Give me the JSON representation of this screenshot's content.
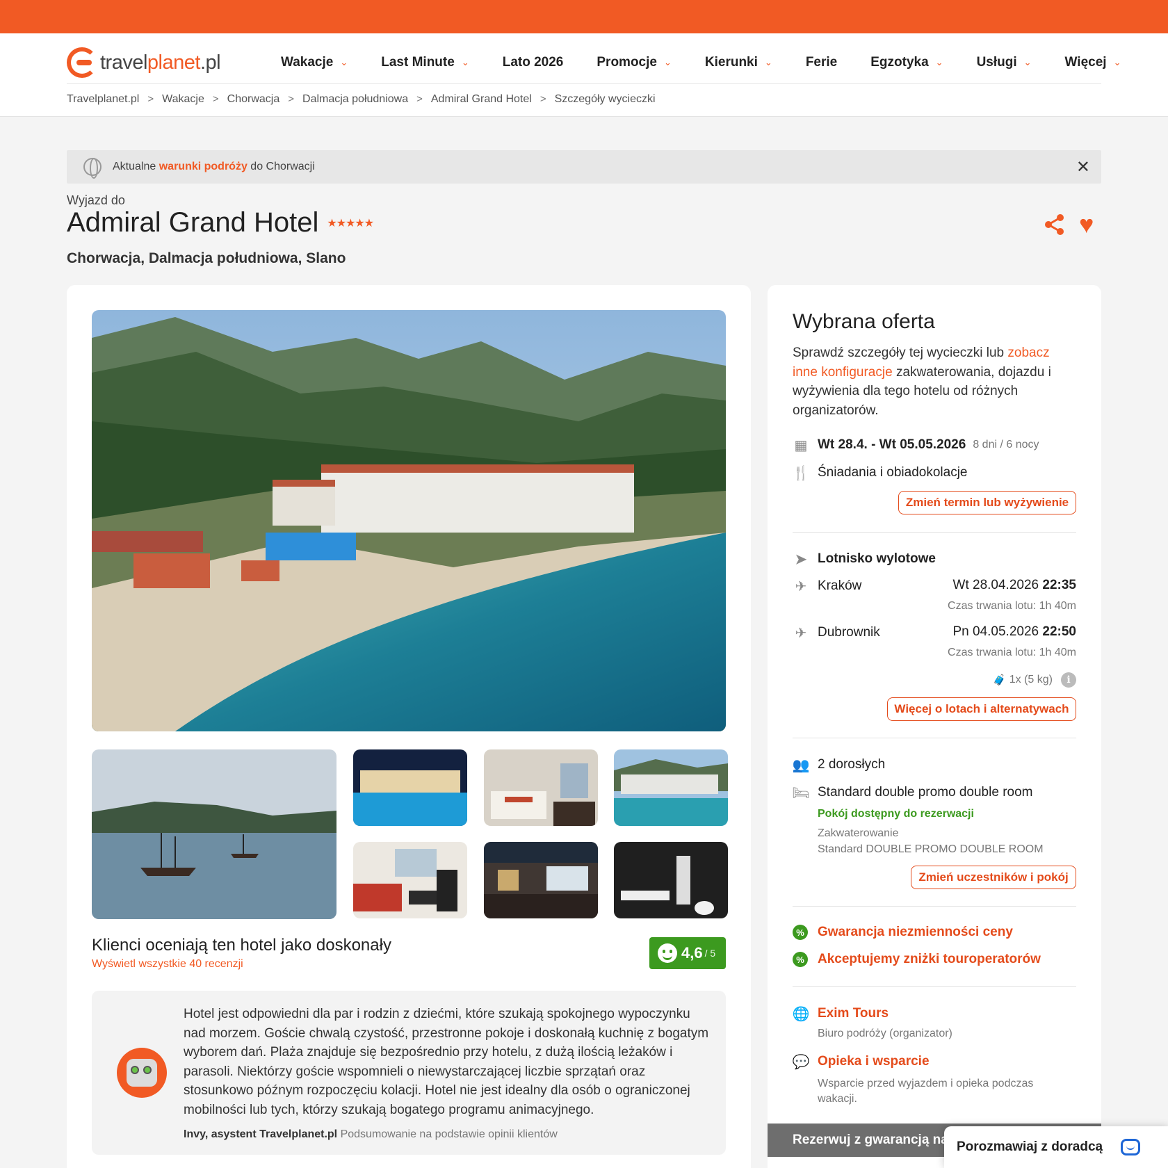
{
  "header": {
    "logo": {
      "part1": "travel",
      "part2": "planet",
      "part3": ".pl"
    },
    "nav": [
      {
        "label": "Wakacje",
        "dropdown": true
      },
      {
        "label": "Last Minute",
        "dropdown": true
      },
      {
        "label": "Lato 2026",
        "dropdown": false
      },
      {
        "label": "Promocje",
        "dropdown": true
      },
      {
        "label": "Kierunki",
        "dropdown": true
      },
      {
        "label": "Ferie",
        "dropdown": false
      },
      {
        "label": "Egzotyka",
        "dropdown": true
      },
      {
        "label": "Usługi",
        "dropdown": true
      },
      {
        "label": "Więcej",
        "dropdown": true
      }
    ],
    "breadcrumb": [
      "Travelplanet.pl",
      "Wakacje",
      "Chorwacja",
      "Dalmacja południowa",
      "Admiral Grand Hotel",
      "Szczegóły wycieczki"
    ]
  },
  "notice": {
    "prefix": "Aktualne",
    "link": "warunki podróży",
    "suffix": "do Chorwacji"
  },
  "hotel": {
    "pretitle": "Wyjazd do",
    "name": "Admiral Grand Hotel",
    "stars": "★★★★★",
    "location": "Chorwacja, Dalmacja południowa, Slano"
  },
  "reviews": {
    "heading": "Klienci oceniają ten hotel jako doskonały",
    "link": "Wyświetl wszystkie 40 recenzji",
    "rating": "4,6",
    "rating_max": "/ 5",
    "summary": "Hotel jest odpowiedni dla par i rodzin z dziećmi, które szukają spokojnego wypoczynku nad morzem. Goście chwalą czystość, przestronne pokoje i doskonałą kuchnię z bogatym wyborem dań. Plaża znajduje się bezpośrednio przy hotelu, z dużą ilością leżaków i parasoli. Niektórzy goście wspomnieli o niewystarczającej liczbie sprzątań oraz stosunkowo późnym rozpoczęciu kolacji. Hotel nie jest idealny dla osób o ograniczonej mobilności lub tych, którzy szukają bogatego programu animacyjnego.",
    "author": "Invy, asystent Travelplanet.pl",
    "author_note": "Podsumowanie na podstawie opinii klientów"
  },
  "offer": {
    "title": "Wybrana oferta",
    "desc_1": "Sprawdź szczegóły tej wycieczki lub",
    "desc_link": "zobacz inne konfiguracje",
    "desc_2": "zakwaterowania, dojazdu i wyżywienia dla tego hotelu od różnych organizatorów.",
    "dates": "Wt 28.4. - Wt 05.05.2026",
    "duration": "8 dni / 6 nocy",
    "board": "Śniadania i obiadokolacje",
    "change_term_btn": "Zmień termin lub wyżywienie",
    "airport_label": "Lotnisko wylotowe",
    "outbound": {
      "city": "Kraków",
      "date": "Wt 28.04.2026",
      "time": "22:35",
      "duration": "Czas trwania lotu: 1h 40m"
    },
    "inbound": {
      "city": "Dubrownik",
      "date": "Pn 04.05.2026",
      "time": "22:50",
      "duration": "Czas trwania lotu: 1h 40m"
    },
    "luggage": "1x (5 kg)",
    "flights_btn": "Więcej o lotach i alternatywach",
    "travellers": "2 dorosłych",
    "room": "Standard double promo double room",
    "room_status": "Pokój dostępny do rezerwacji",
    "accommodation_label": "Zakwaterowanie",
    "accommodation_value": "Standard DOUBLE PROMO DOUBLE ROOM",
    "change_room_btn": "Zmień uczestników i pokój",
    "guarantee_1": "Gwarancja niezmienności ceny",
    "guarantee_2": "Akceptujemy zniżki touroperatorów",
    "organizer": "Exim Tours",
    "organizer_note": "Biuro podróży (organizator)",
    "support": "Opieka i wsparcie",
    "support_note": "Wsparcie przed wyjazdem i opieka podczas wakacji.",
    "book_bar": "Rezerwuj z gwarancją naj"
  },
  "chat": {
    "label": "Porozmawiaj z doradcą"
  },
  "colors": {
    "brand": "#f15a24",
    "rating": "#3c9a1f"
  }
}
